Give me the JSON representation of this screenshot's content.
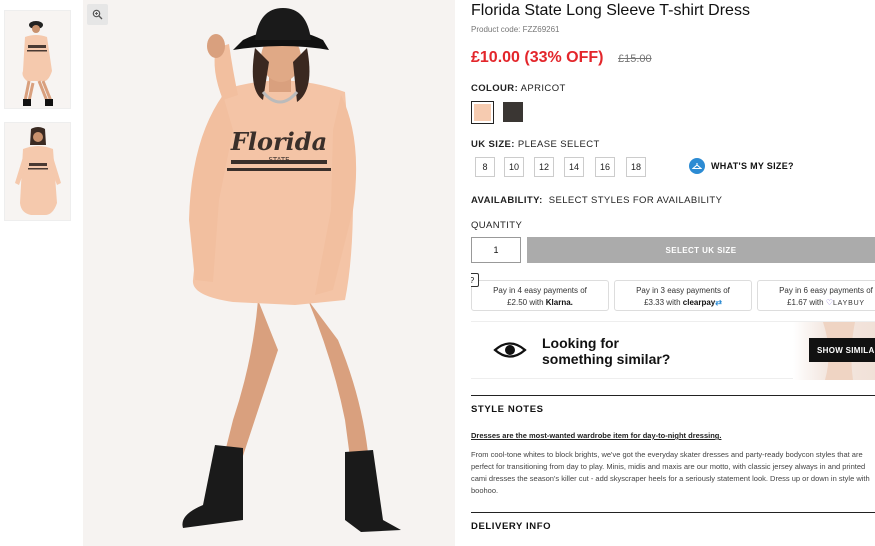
{
  "product": {
    "title": "Florida State Long Sleeve T-shirt Dress",
    "code": "Product code: FZZ69261",
    "price": "£10.00 (33% OFF)",
    "old_price": "£15.00",
    "model_print": {
      "line1": "Florida",
      "line2": "STATE"
    }
  },
  "colour": {
    "label": "COLOUR:",
    "value": "APRICOT",
    "swatches": [
      {
        "name": "apricot",
        "color": "#f6cbb0"
      },
      {
        "name": "black",
        "color": "#3a3633"
      }
    ]
  },
  "size": {
    "label": "UK SIZE:",
    "value": "PLEASE SELECT",
    "options": [
      "8",
      "10",
      "12",
      "14",
      "16",
      "18"
    ],
    "help_label": "WHAT'S MY SIZE?"
  },
  "availability": {
    "label": "AVAILABILITY:",
    "value": "SELECT STYLES FOR AVAILABILITY"
  },
  "quantity": {
    "label": "QUANTITY",
    "value": "1"
  },
  "add_button": "SELECT UK SIZE",
  "help_mark": "?",
  "payments": [
    {
      "line1": "Pay in 4 easy payments of",
      "amount": "£2.50 with",
      "brand": "Klarna."
    },
    {
      "line1": "Pay in 3 easy payments of",
      "amount": "£3.33 with",
      "brand": "clearpay"
    },
    {
      "line1": "Pay in 6 easy payments of",
      "amount": "£1.67 with",
      "brand": "LAYBUY"
    }
  ],
  "similar": {
    "line1": "Looking for",
    "line2": "something similar?",
    "button": "SHOW SIMILAR"
  },
  "style_notes": {
    "title": "STYLE NOTES",
    "lead": "Dresses are the most-wanted wardrobe item for day-to-night dressing.",
    "body": "From cool-tone whites to block brights, we've got the everyday skater dresses and party-ready bodycon styles that are perfect for transitioning from day to play. Minis, midis and maxis are our motto, with classic jersey always in and printed cami dresses the season's killer cut - add skyscraper heels for a seriously statement look. Dress up or down in style with boohoo."
  },
  "delivery": {
    "title": "DELIVERY INFO"
  },
  "colors": {
    "price_red": "#e3262b",
    "button_grey": "#ababab",
    "accent_blue": "#2c8bd3",
    "dress_apricot": "#f6cbb0"
  }
}
